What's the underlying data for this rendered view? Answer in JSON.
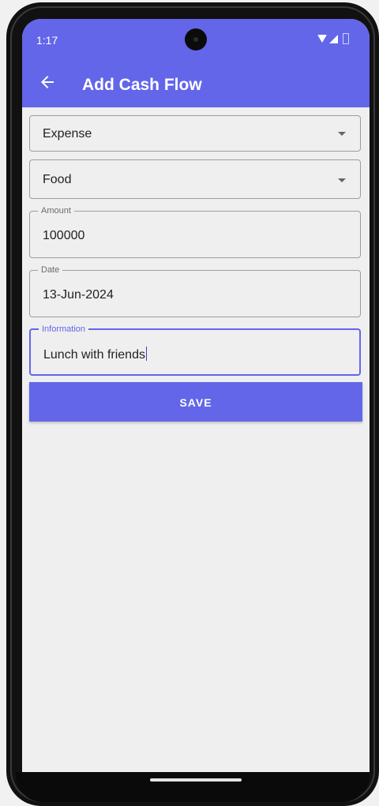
{
  "status_bar": {
    "time": "1:17"
  },
  "app_bar": {
    "title": "Add Cash Flow"
  },
  "form": {
    "type_select": {
      "value": "Expense"
    },
    "category_select": {
      "value": "Food"
    },
    "amount": {
      "label": "Amount",
      "value": "100000"
    },
    "date": {
      "label": "Date",
      "value": "13-Jun-2024"
    },
    "information": {
      "label": "Information",
      "value": "Lunch with friends"
    }
  },
  "save_button": {
    "label": "SAVE"
  },
  "colors": {
    "primary": "#6366e9",
    "background": "#efefef"
  },
  "icons": [
    "back-arrow-icon",
    "dropdown-arrow-icon",
    "wifi-icon",
    "signal-icon",
    "battery-icon"
  ]
}
